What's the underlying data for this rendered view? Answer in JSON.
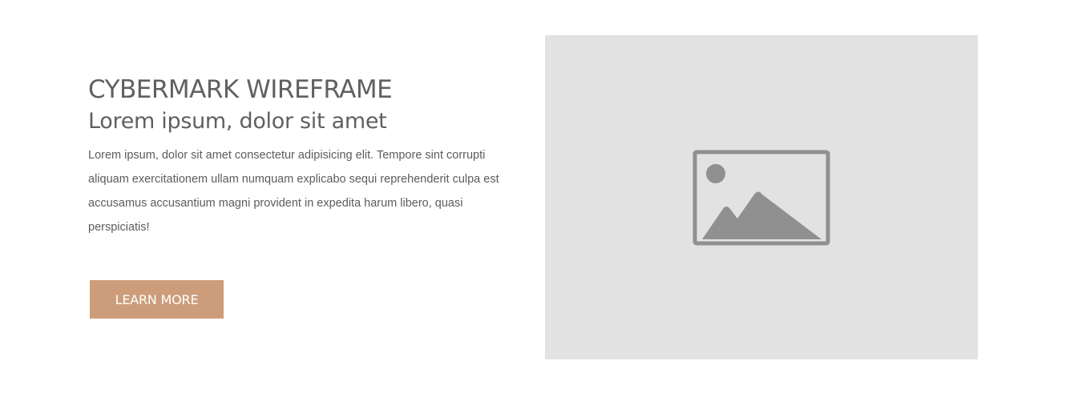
{
  "hero": {
    "eyebrow": "CYBERMARK WIREFRAME",
    "title": "Lorem ipsum, dolor sit amet",
    "body": "Lorem ipsum, dolor sit amet consectetur adipisicing elit. Tempore sint corrupti aliquam exercitationem ullam numquam explicabo sequi reprehenderit culpa est accusamus accusantium magni provident in expedita harum libero, quasi perspiciatis!",
    "cta_label": "LEARN MORE"
  },
  "media": {
    "icon": "image-placeholder-icon"
  },
  "colors": {
    "accent": "#cd9d7b",
    "text": "#606060",
    "placeholder_bg": "#e2e2e2",
    "placeholder_icon": "#909090"
  }
}
